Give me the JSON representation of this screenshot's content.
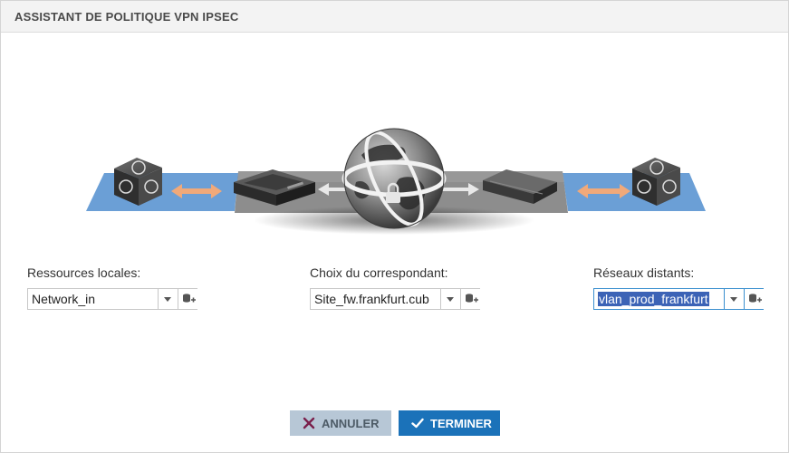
{
  "dialog": {
    "title": "ASSISTANT DE POLITIQUE VPN IPSEC"
  },
  "fields": {
    "local": {
      "label": "Ressources locales:",
      "value": "Network_in"
    },
    "peer": {
      "label": "Choix du correspondant:",
      "value": "Site_fw.frankfurt.cub"
    },
    "remote": {
      "label": "Réseaux distants:",
      "value": "vlan_prod_frankfurt"
    }
  },
  "buttons": {
    "cancel": "ANNULER",
    "finish": "TERMINER"
  },
  "icons": {
    "dropdown": "chevron-down-icon",
    "add": "add-object-icon",
    "cancel": "close-icon",
    "finish": "check-icon"
  },
  "colors": {
    "primary": "#1b72b9",
    "secondary": "#b7c7d6",
    "selection": "#3c63b6",
    "cancel_icon": "#7a1f4b"
  }
}
